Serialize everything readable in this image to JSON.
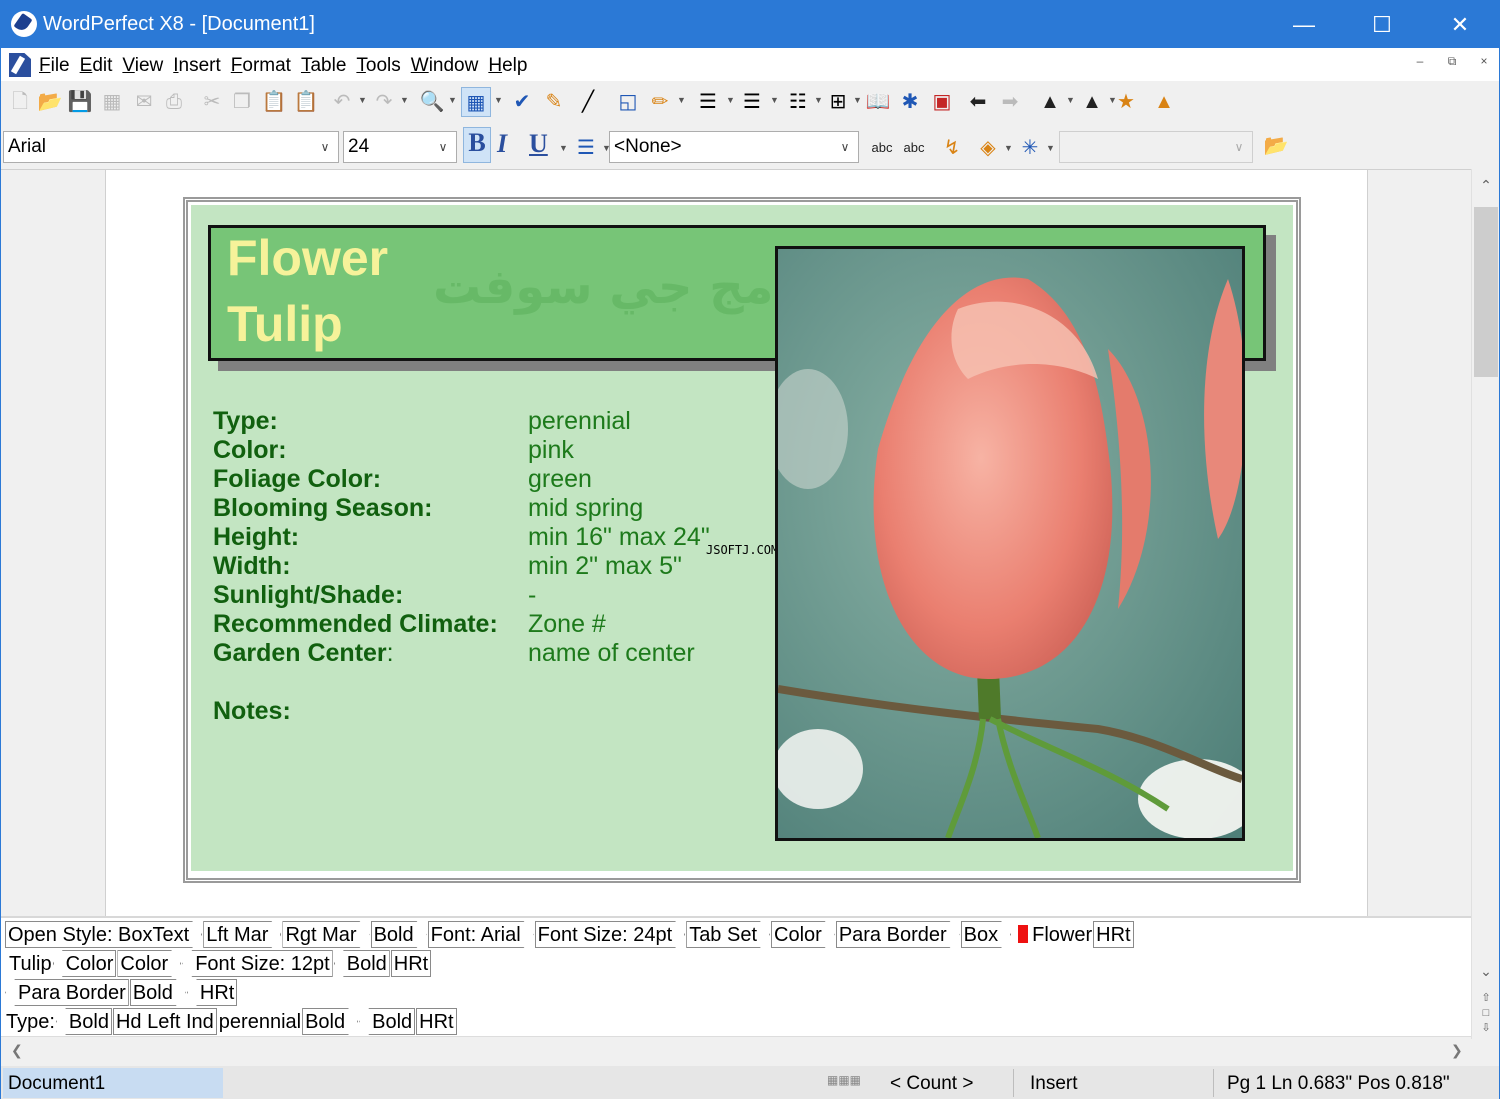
{
  "window": {
    "title": "WordPerfect X8 - [Document1]"
  },
  "menu": [
    "File",
    "Edit",
    "View",
    "Insert",
    "Format",
    "Table",
    "Tools",
    "Window",
    "Help"
  ],
  "toolbar": {
    "font_name": "Arial",
    "font_size": "24",
    "style_name": "<None>",
    "bold": "B",
    "italic": "I",
    "underline": "U"
  },
  "card": {
    "title_line1": "Flower",
    "title_line2": "Tulip",
    "watermark": "برامج جي سوفت",
    "site": "JSOFTJ.COM",
    "rows": [
      {
        "label": "Type:",
        "value": "perennial"
      },
      {
        "label": "Color:",
        "value": "pink"
      },
      {
        "label": "Foliage Color:",
        "value": "green"
      },
      {
        "label": "Blooming Season:",
        "value": "mid spring"
      },
      {
        "label": "Height:",
        "value": "min 16\" max 24\""
      },
      {
        "label": "Width:",
        "value": "min 2\" max 5\""
      },
      {
        "label": "Sunlight/Shade:",
        "value": "-"
      },
      {
        "label": "Recommended Climate:",
        "value": "Zone #"
      },
      {
        "label": "Garden Center",
        "value": "name of center"
      }
    ],
    "notes": "Notes:"
  },
  "reveal": {
    "row1": [
      "Open Style: BoxText",
      "Lft Mar",
      "Rgt Mar",
      "Bold",
      "Font: Arial",
      "Font Size: 24pt",
      "Tab Set",
      "Color",
      "Para Border",
      "Box",
      "Flower",
      "HRt"
    ],
    "row2": [
      "Tulip",
      "Color",
      "Color",
      "Font Size: 12pt",
      "Bold",
      "HRt"
    ],
    "row3": [
      "Para Border",
      "Bold",
      "HRt"
    ],
    "row4": [
      "Type:",
      "Bold",
      "Hd Left Ind",
      "perennial",
      "Bold",
      "Bold",
      "HRt"
    ]
  },
  "status": {
    "document": "Document1",
    "count": "< Count >",
    "mode": "Insert",
    "position": "Pg 1 Ln 0.683\" Pos 0.818\""
  }
}
